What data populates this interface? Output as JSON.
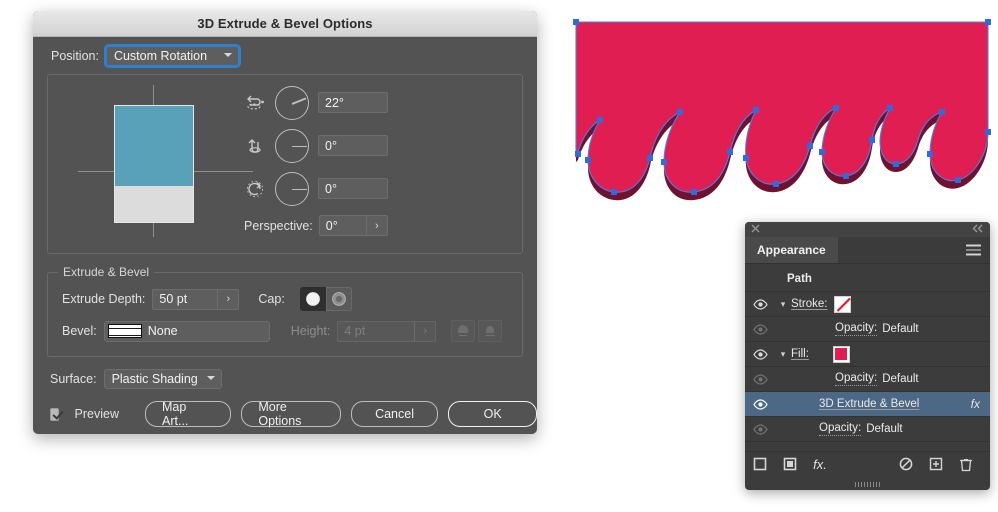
{
  "dialog": {
    "title": "3D Extrude & Bevel Options",
    "position_label": "Position:",
    "position_value": "Custom Rotation",
    "rotations": [
      {
        "axis_icon": "rotate-x-icon",
        "value": "22°",
        "angle": 22
      },
      {
        "axis_icon": "rotate-y-icon",
        "value": "0°",
        "angle": 0
      },
      {
        "axis_icon": "rotate-z-icon",
        "value": "0°",
        "angle": 0
      }
    ],
    "perspective_label": "Perspective:",
    "perspective_value": "0°",
    "extrude_group_title": "Extrude & Bevel",
    "extrude_depth_label": "Extrude Depth:",
    "extrude_depth_value": "50 pt",
    "cap_label": "Cap:",
    "cap_options": [
      "cap-on-icon",
      "cap-off-icon"
    ],
    "cap_selected": 0,
    "bevel_label": "Bevel:",
    "bevel_value": "None",
    "height_label": "Height:",
    "height_value": "4 pt",
    "bevel_extent_buttons": [
      "bevel-extent-out-icon",
      "bevel-extent-in-icon"
    ],
    "surface_label": "Surface:",
    "surface_value": "Plastic Shading",
    "preview_label": "Preview",
    "preview_checked": true,
    "buttons": [
      {
        "label": "Map Art...",
        "primary": false
      },
      {
        "label": "More Options",
        "primary": false
      },
      {
        "label": "Cancel",
        "primary": false
      },
      {
        "label": "OK",
        "primary": true
      }
    ]
  },
  "artwork": {
    "fill_color": "#e01e51",
    "extrude_color": "#6e122e",
    "path_color": "#4a7fe8",
    "anchor_color": "#2f6bdd"
  },
  "panel": {
    "close_icon": "close-icon",
    "collapse_icon": "collapse-icon",
    "tab_label": "Appearance",
    "menu_icon": "hamburger-menu-icon",
    "header_row": "Path",
    "rows": [
      {
        "type": "stroke",
        "label": "Stroke:",
        "swatch": "none",
        "visible": true,
        "has_disclosure": true,
        "indent": 0,
        "selected": false,
        "fx": false
      },
      {
        "type": "opacity",
        "label": "Opacity:",
        "value": "Default",
        "visible": false,
        "has_disclosure": false,
        "indent": 1,
        "selected": false,
        "fx": false
      },
      {
        "type": "fill",
        "label": "Fill:",
        "swatch": "#e01e51",
        "visible": true,
        "has_disclosure": true,
        "indent": 0,
        "selected": false,
        "fx": false
      },
      {
        "type": "opacity",
        "label": "Opacity:",
        "value": "Default",
        "visible": false,
        "has_disclosure": false,
        "indent": 1,
        "selected": false,
        "fx": false
      },
      {
        "type": "effect",
        "label": "3D Extrude & Bevel",
        "visible": true,
        "has_disclosure": false,
        "indent": 1,
        "selected": true,
        "fx": true
      },
      {
        "type": "opacity",
        "label": "Opacity:",
        "value": "Default",
        "visible": false,
        "has_disclosure": false,
        "indent": 0,
        "selected": false,
        "fx": false
      }
    ],
    "footer_icons": [
      "add-new-stroke-icon",
      "add-new-fill-icon",
      "add-new-effect-icon",
      "clear-appearance-icon",
      "duplicate-item-icon",
      "delete-item-icon"
    ]
  }
}
